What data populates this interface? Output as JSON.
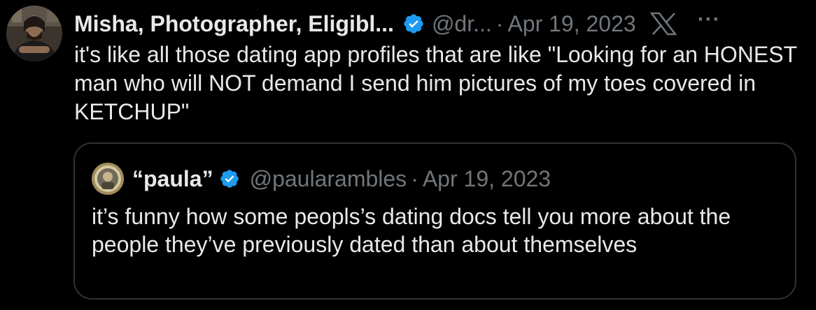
{
  "tweet": {
    "display_name": "Misha, Photographer, Eligibl...",
    "handle": "@dr...",
    "separator": "·",
    "date": "Apr 19, 2023",
    "text": "it's like all those dating app profiles that are like \"Looking for an HONEST man who will NOT demand I send him pictures of my toes covered in KETCHUP\"",
    "more_label": "···",
    "verified_color": "#1d9bf0"
  },
  "quote": {
    "display_name": "“paula”",
    "handle": "@paularambles",
    "separator": "·",
    "date": "Apr 19, 2023",
    "text": "it’s funny how some peopls’s dating docs tell you more about the people they’ve previously dated than about themselves"
  },
  "icons": {
    "verified": "verified-badge-icon",
    "x": "x-logo-icon",
    "more": "more-options-icon"
  }
}
